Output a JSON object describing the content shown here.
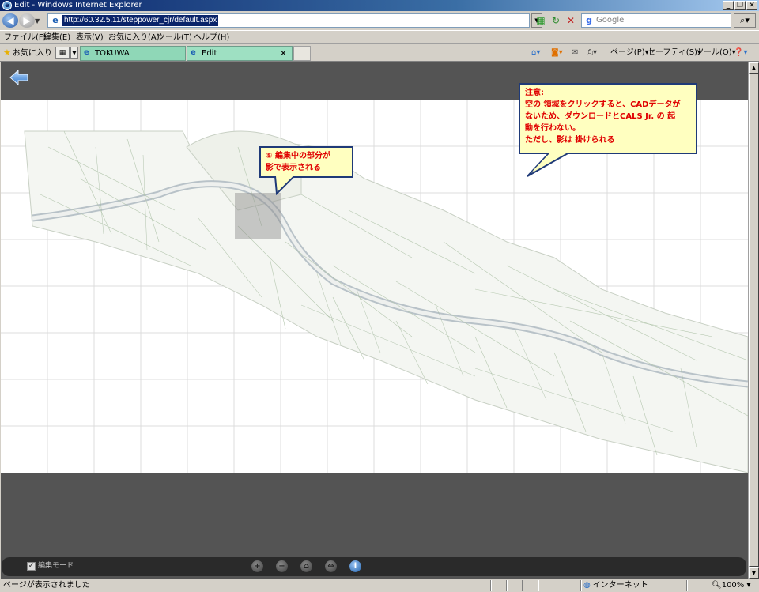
{
  "window": {
    "title": "Edit - Windows Internet Explorer",
    "buttons": [
      "_",
      "❐",
      "✕"
    ]
  },
  "address": {
    "url": "http://60.32.5.11/steppower_cjr/default.aspx",
    "search_placeholder": "Google"
  },
  "menu": {
    "items": [
      "ファイル(F)",
      "編集(E)",
      "表示(V)",
      "お気に入り(A)",
      "ツール(T)",
      "ヘルプ(H)"
    ]
  },
  "tabs": {
    "favorites_label": "お気に入り",
    "items": [
      {
        "label": "TOKUWA"
      },
      {
        "label": "Edit"
      }
    ],
    "commands": {
      "page": "ページ(P)",
      "safety": "セーフティ(S)",
      "tools": "ツール(O)"
    }
  },
  "callouts": {
    "shadow_note": [
      "⑤ 編集中の部分が",
      "影で表示される"
    ],
    "warning": [
      "注意:",
      "空の 領域をクリックすると、CADデータが",
      "ないため、ダウンロードとCALS  Jr.  の 起",
      "動を行わない。",
      "ただし、影は 掛けられる"
    ]
  },
  "controls": {
    "mode_label": "編集モード",
    "mode_checked": true
  },
  "status": {
    "text": "ページが表示されました",
    "zone": "インターネット",
    "zoom": "100%"
  },
  "icons": [
    "ie-logo-icon",
    "back-icon",
    "forward-icon",
    "refresh-icon",
    "stop-icon",
    "google-icon",
    "search-go-icon",
    "star-icon",
    "home-icon",
    "feed-icon",
    "mail-icon",
    "print-icon",
    "help-icon",
    "back-arrow-icon",
    "zoom-in-icon",
    "zoom-out-icon",
    "home-view-icon",
    "fit-icon",
    "info-icon",
    "globe-icon"
  ],
  "colors": {
    "viewer_bg": "#545454",
    "callout_bg": "#ffffc0",
    "callout_text": "#e00000",
    "callout_border": "#1f3a78",
    "tab_active": "#8fd7b7"
  }
}
